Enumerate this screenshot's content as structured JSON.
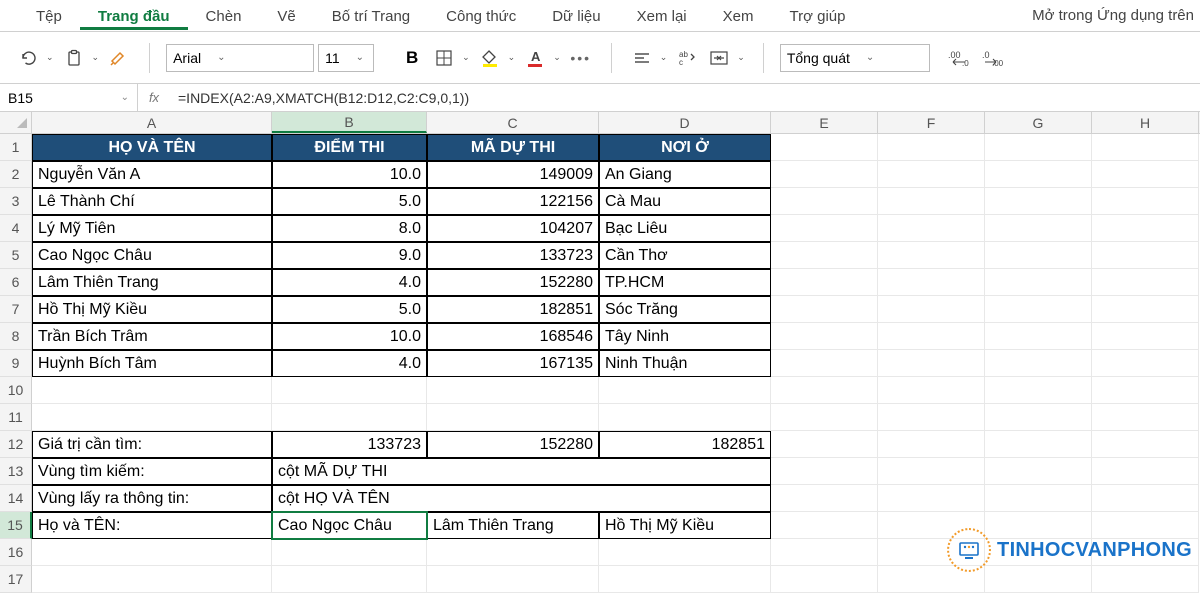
{
  "tabs": [
    "Tệp",
    "Trang đầu",
    "Chèn",
    "Vẽ",
    "Bố trí Trang",
    "Công thức",
    "Dữ liệu",
    "Xem lại",
    "Xem",
    "Trợ giúp"
  ],
  "active_tab": 1,
  "ribbon_right": "Mở trong Ứng dụng trên",
  "toolbar": {
    "font_name": "Arial",
    "font_size": "11",
    "number_format": "Tổng quát"
  },
  "name_box": "B15",
  "formula": "=INDEX(A2:A9,XMATCH(B12:D12,C2:C9,0,1))",
  "columns": [
    "A",
    "B",
    "C",
    "D",
    "E",
    "F",
    "G",
    "H"
  ],
  "col_widths": {
    "A": 240,
    "B": 155,
    "C": 172,
    "D": 172,
    "E": 107,
    "F": 107,
    "G": 107,
    "H": 107
  },
  "active_col": "B",
  "active_row": 15,
  "headers": [
    "HỌ VÀ TÊN",
    "ĐIỂM THI",
    "MÃ DỰ THI",
    "NƠI Ở"
  ],
  "table_rows": [
    {
      "a": "Nguyễn Văn A",
      "b": "10.0",
      "c": "149009",
      "d": "An Giang"
    },
    {
      "a": "Lê Thành Chí",
      "b": "5.0",
      "c": "122156",
      "d": "Cà Mau"
    },
    {
      "a": "Lý Mỹ Tiên",
      "b": "8.0",
      "c": "104207",
      "d": "Bạc Liêu"
    },
    {
      "a": "Cao Ngọc Châu",
      "b": "9.0",
      "c": "133723",
      "d": "Cần Thơ"
    },
    {
      "a": "Lâm Thiên Trang",
      "b": "4.0",
      "c": "152280",
      "d": "TP.HCM"
    },
    {
      "a": "Hồ Thị Mỹ Kiều",
      "b": "5.0",
      "c": "182851",
      "d": "Sóc Trăng"
    },
    {
      "a": "Trần Bích Trâm",
      "b": "10.0",
      "c": "168546",
      "d": "Tây Ninh"
    },
    {
      "a": "Huỳnh Bích Tâm",
      "b": "4.0",
      "c": "167135",
      "d": "Ninh Thuận"
    }
  ],
  "lookup": {
    "r12": {
      "a": "Giá trị cần tìm:",
      "b": "133723",
      "c": "152280",
      "d": "182851"
    },
    "r13": {
      "a": "Vùng tìm kiếm:",
      "b": "cột MÃ DỰ THI"
    },
    "r14": {
      "a": "Vùng lấy ra thông tin:",
      "b": "cột HỌ VÀ TÊN"
    },
    "r15": {
      "a": "Họ và TÊN:",
      "b": "Cao Ngọc Châu",
      "c": "Lâm Thiên Trang",
      "d": "Hồ Thị Mỹ Kiều"
    }
  },
  "watermark": "TINHOCVANPHONG"
}
